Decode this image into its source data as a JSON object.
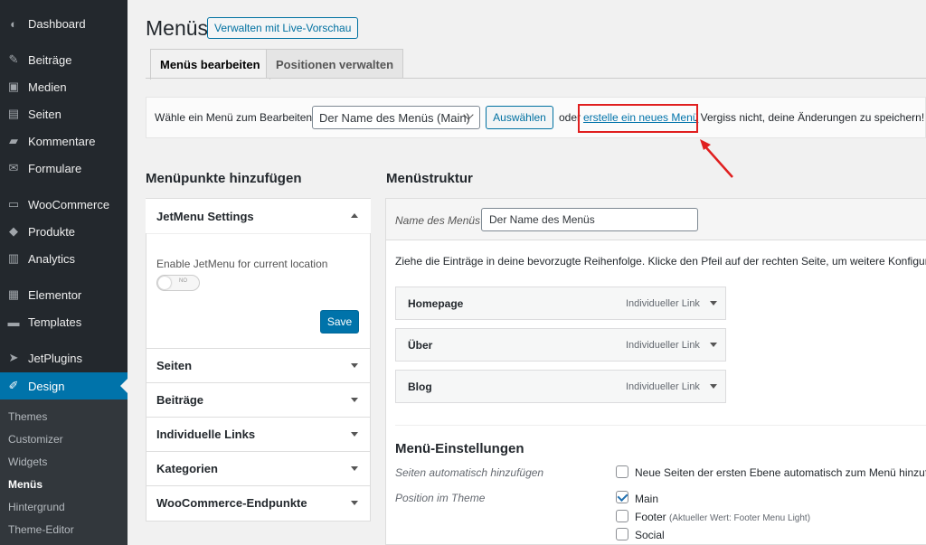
{
  "sidebar": {
    "items": [
      {
        "label": "Dashboard",
        "icon": "dashboard-icon"
      },
      {
        "label": "Beiträge",
        "icon": "pin-icon"
      },
      {
        "label": "Medien",
        "icon": "media-icon"
      },
      {
        "label": "Seiten",
        "icon": "pages-icon"
      },
      {
        "label": "Kommentare",
        "icon": "comment-icon"
      },
      {
        "label": "Formulare",
        "icon": "mail-icon"
      },
      {
        "label": "WooCommerce",
        "icon": "woo-icon"
      },
      {
        "label": "Produkte",
        "icon": "box-icon"
      },
      {
        "label": "Analytics",
        "icon": "bar-chart-icon"
      },
      {
        "label": "Elementor",
        "icon": "elementor-icon"
      },
      {
        "label": "Templates",
        "icon": "folder-icon"
      },
      {
        "label": "JetPlugins",
        "icon": "jet-icon"
      },
      {
        "label": "Design",
        "icon": "brush-icon"
      }
    ],
    "submenu": [
      "Themes",
      "Customizer",
      "Widgets",
      "Menüs",
      "Hintergrund",
      "Theme-Editor"
    ]
  },
  "header": {
    "title": "Menüs",
    "preview_button": "Verwalten mit Live-Vorschau"
  },
  "tabs": [
    "Menüs bearbeiten",
    "Positionen verwalten"
  ],
  "select_bar": {
    "label": "Wähle ein Menü zum Bearbeiten:",
    "selected_menu": "Der Name des Menüs (Main)",
    "select_button": "Auswählen",
    "or_text": "oder",
    "create_link": "erstelle ein neues Menü",
    "remember_text": ". Vergiss nicht, deine Änderungen zu speichern!"
  },
  "left": {
    "heading": "Menüpunkte hinzufügen",
    "jetmenu": {
      "title": "JetMenu Settings",
      "enable_label": "Enable JetMenu for current location",
      "toggle_text": "NO",
      "save_label": "Save"
    },
    "sections": [
      "Seiten",
      "Beiträge",
      "Individuelle Links",
      "Kategorien",
      "WooCommerce-Endpunkte"
    ]
  },
  "right": {
    "heading": "Menüstruktur",
    "name_label": "Name des Menüs",
    "name_value": "Der Name des Menüs",
    "instructions": "Ziehe die Einträge in deine bevorzugte Reihenfolge. Klicke den Pfeil auf der rechten Seite, um weitere Konfigurations",
    "items": [
      {
        "title": "Homepage",
        "type": "Individueller Link"
      },
      {
        "title": "Über",
        "type": "Individueller Link"
      },
      {
        "title": "Blog",
        "type": "Individueller Link"
      }
    ],
    "settings": {
      "title": "Menü-Einstellungen",
      "auto_add_label": "Seiten automatisch hinzufügen",
      "auto_add_option": "Neue Seiten der ersten Ebene automatisch zum Menü hinzufüge",
      "position_label": "Position im Theme",
      "positions": [
        {
          "name": "Main",
          "note": "",
          "checked": true
        },
        {
          "name": "Footer",
          "note": "(Aktueller Wert: Footer Menu Light)",
          "checked": false
        },
        {
          "name": "Social",
          "note": "",
          "checked": false
        }
      ]
    }
  },
  "colors": {
    "sidebar_bg": "#23282d",
    "accent": "#0073aa",
    "highlight": "#e01f1f"
  }
}
